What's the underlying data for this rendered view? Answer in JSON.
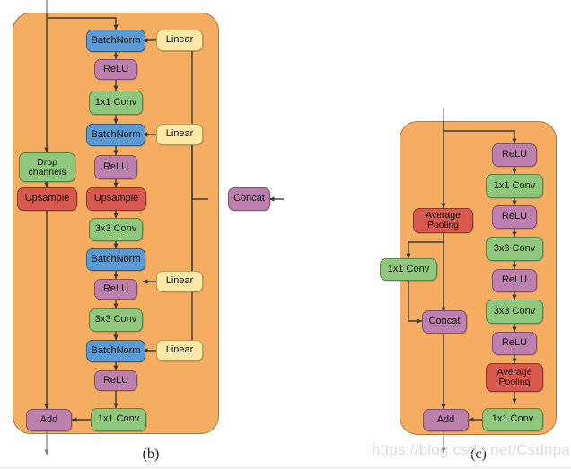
{
  "figure": {
    "watermark": "https://blog.csdn.net/Csdnpai",
    "colors": {
      "panel_fill": "#f4ad61",
      "panel_stroke": "#b3793a",
      "batchnorm": "#5b9bd5",
      "relu": "#bd80ae",
      "conv": "#8fc87c",
      "linear": "#fbe7a6",
      "pool_upsample": "#d8594f",
      "wire": "#3a3a3a",
      "background": "#ffffff"
    }
  },
  "panels": [
    {
      "id": "b",
      "caption": "(b)",
      "nodes": [
        {
          "key": "b_bn1",
          "label": "BatchNorm",
          "type": "batchnorm"
        },
        {
          "key": "b_linear1",
          "label": "Linear",
          "type": "linear"
        },
        {
          "key": "b_relu1",
          "label": "ReLU",
          "type": "relu"
        },
        {
          "key": "b_conv1x1_a",
          "label": "1x1 Conv",
          "type": "conv"
        },
        {
          "key": "b_bn2",
          "label": "BatchNorm",
          "type": "batchnorm"
        },
        {
          "key": "b_linear2",
          "label": "Linear",
          "type": "linear"
        },
        {
          "key": "b_drop",
          "label": "Drop\nchannels",
          "type": "conv"
        },
        {
          "key": "b_relu2",
          "label": "ReLU",
          "type": "relu"
        },
        {
          "key": "b_ups_left",
          "label": "Upsample",
          "type": "pool_upsample"
        },
        {
          "key": "b_ups_main",
          "label": "Upsample",
          "type": "pool_upsample"
        },
        {
          "key": "b_concat",
          "label": "Concat",
          "type": "relu"
        },
        {
          "key": "b_conv3x3_a",
          "label": "3x3 Conv",
          "type": "conv"
        },
        {
          "key": "b_bn3",
          "label": "BatchNorm",
          "type": "batchnorm"
        },
        {
          "key": "b_linear3",
          "label": "Linear",
          "type": "linear"
        },
        {
          "key": "b_relu3",
          "label": "ReLU",
          "type": "relu"
        },
        {
          "key": "b_conv3x3_b",
          "label": "3x3 Conv",
          "type": "conv"
        },
        {
          "key": "b_bn4",
          "label": "BatchNorm",
          "type": "batchnorm"
        },
        {
          "key": "b_linear4",
          "label": "Linear",
          "type": "linear"
        },
        {
          "key": "b_relu4",
          "label": "ReLU",
          "type": "relu"
        },
        {
          "key": "b_add",
          "label": "Add",
          "type": "relu"
        },
        {
          "key": "b_conv1x1_b",
          "label": "1x1 Conv",
          "type": "conv"
        }
      ]
    },
    {
      "id": "c",
      "caption": "(c)",
      "nodes": [
        {
          "key": "c_relu1",
          "label": "ReLU",
          "type": "relu"
        },
        {
          "key": "c_conv1x1_a",
          "label": "1x1 Conv",
          "type": "conv"
        },
        {
          "key": "c_relu2",
          "label": "ReLU",
          "type": "relu"
        },
        {
          "key": "c_avgpool_l",
          "label": "Average\nPooling",
          "type": "pool_upsample"
        },
        {
          "key": "c_conv3x3_a",
          "label": "3x3 Conv",
          "type": "conv"
        },
        {
          "key": "c_conv1x1_l",
          "label": "1x1 Conv",
          "type": "conv"
        },
        {
          "key": "c_relu3",
          "label": "ReLU",
          "type": "relu"
        },
        {
          "key": "c_concat",
          "label": "Concat",
          "type": "relu"
        },
        {
          "key": "c_conv3x3_b",
          "label": "3x3 Conv",
          "type": "conv"
        },
        {
          "key": "c_relu4",
          "label": "ReLU",
          "type": "relu"
        },
        {
          "key": "c_avgpool_r",
          "label": "Average\nPooling",
          "type": "pool_upsample"
        },
        {
          "key": "c_add",
          "label": "Add",
          "type": "relu"
        },
        {
          "key": "c_conv1x1_b",
          "label": "1x1 Conv",
          "type": "conv"
        }
      ]
    }
  ]
}
